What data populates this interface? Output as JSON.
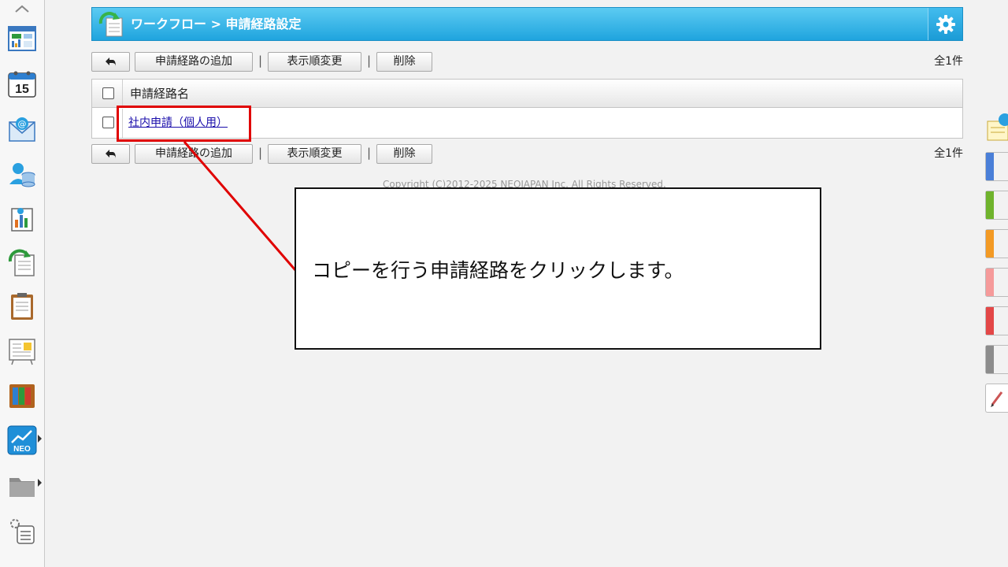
{
  "header": {
    "title": "ワークフロー > 申請経路設定"
  },
  "toolbar": {
    "add_label": "申請経路の追加",
    "reorder_label": "表示順変更",
    "delete_label": "削除",
    "separator": "|",
    "count": "全1件"
  },
  "table": {
    "column_header": "申請経路名",
    "rows": [
      {
        "name": "社内申請（個人用）"
      }
    ]
  },
  "footer": {
    "copyright": "Copyright (C)2012-2025 NEOJAPAN Inc. All Rights Reserved."
  },
  "annotation": {
    "instruction": "コピーを行う申請経路をクリックします。"
  },
  "sidebar": {
    "calendar_day": "15",
    "neo_label": "NEO"
  },
  "colors": {
    "header_gradient_top": "#5ccbf2",
    "header_gradient_bottom": "#1fa4de",
    "highlight": "#e00000",
    "link": "#1a0dab",
    "right_tabs": [
      "#4a7fd8",
      "#6fb32c",
      "#f39a24",
      "#f59a9a",
      "#e34747",
      "#8c8c8c"
    ]
  },
  "icons": [
    "chevron-up-icon",
    "portal-icon",
    "calendar-icon",
    "webmail-icon",
    "address-book-icon",
    "report-icon",
    "workflow-icon",
    "memo-icon",
    "bulletin-icon",
    "cabinet-icon",
    "neo-app-icon",
    "folder-icon",
    "settings-list-icon",
    "back-arrow-icon",
    "gear-icon"
  ]
}
